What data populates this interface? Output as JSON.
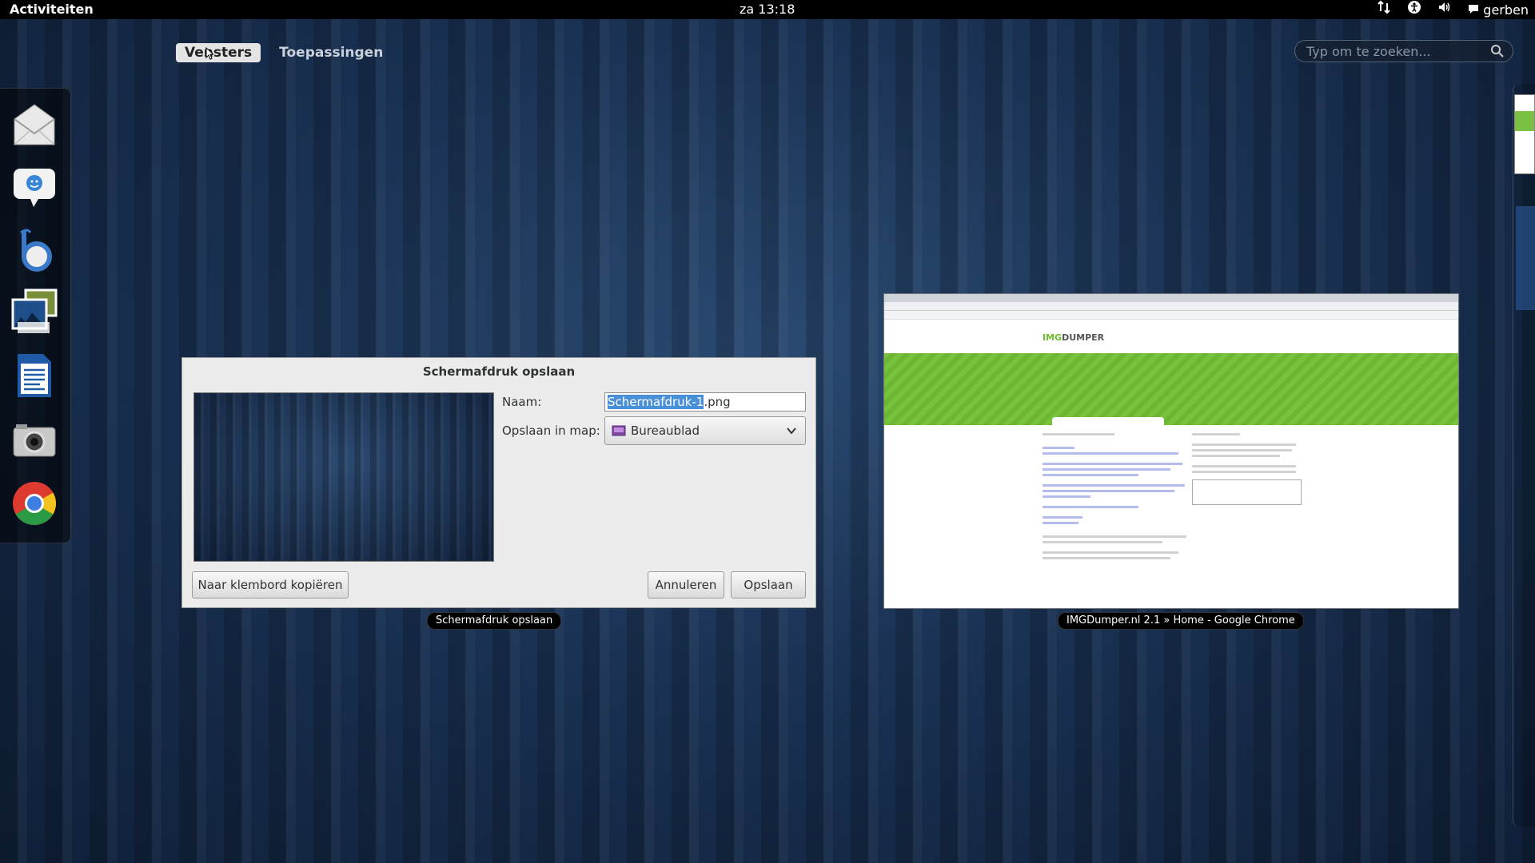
{
  "topbar": {
    "activities": "Activiteiten",
    "clock": "za 13:18",
    "user": "gerben",
    "icons": [
      "network-icon",
      "accessibility-icon",
      "volume-icon",
      "chat-icon"
    ]
  },
  "overview": {
    "tabs": [
      {
        "label": "Vensters",
        "active": true
      },
      {
        "label": "Toepassingen",
        "active": false
      }
    ],
    "search_placeholder": "Typ om te zoeken..."
  },
  "dash": {
    "items": [
      "mail-icon",
      "empathy-chat-icon",
      "banshee-icon",
      "shotwell-photos-icon",
      "writer-document-icon",
      "camera-icon",
      "chrome-icon"
    ]
  },
  "dialog": {
    "title": "Schermafdruk opslaan",
    "name_label": "Naam:",
    "name_selected": "Schermafdruk-1",
    "name_rest": ".png",
    "folder_label": "Opslaan in map:",
    "folder_value": "Bureaublad",
    "copy_button": "Naar klembord kopiëren",
    "cancel_button": "Annuleren",
    "save_button": "Opslaan"
  },
  "windows": {
    "dialog_caption": "Schermafdruk opslaan",
    "chrome_caption": "IMGDumper.nl 2.1 » Home - Google Chrome"
  },
  "colors": {
    "accent": "#4a90d9",
    "site_green": "#77c43c",
    "panel": "#000000"
  }
}
